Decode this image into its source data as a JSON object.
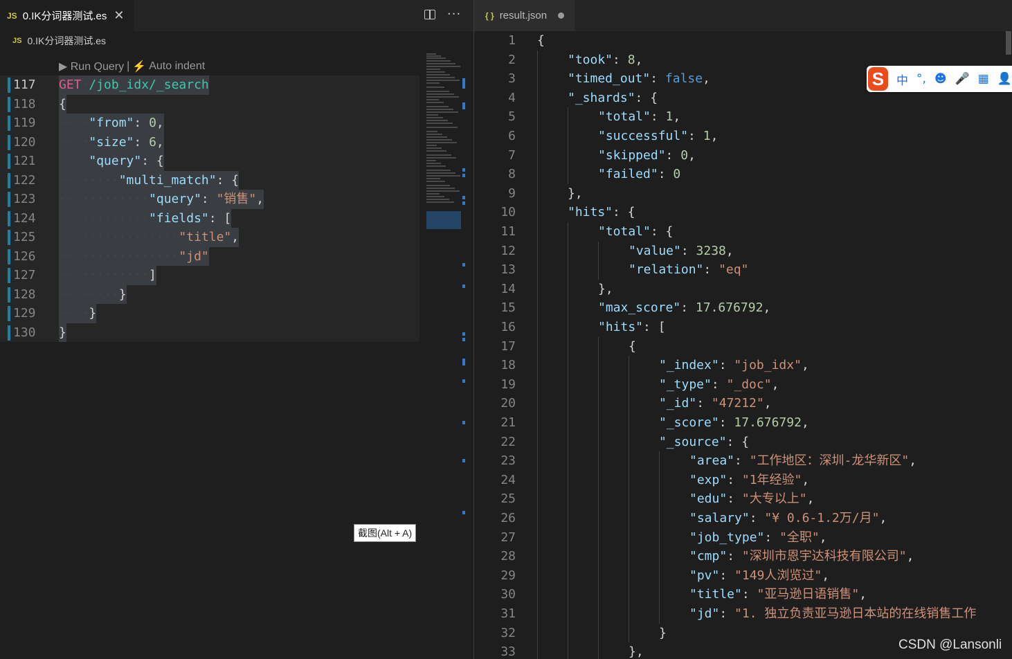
{
  "left_editor": {
    "tab": {
      "badge": "JS",
      "title": "0.IK分词器测试.es",
      "close": "✕"
    },
    "actions": {
      "split": "split-editor",
      "more": "···"
    },
    "breadcrumb": {
      "badge": "JS",
      "file": "0.IK分词器测试.es"
    },
    "codelens": {
      "run": "▶ Run Query",
      "sep": "|",
      "bolt": "⚡",
      "indent": "Auto indent"
    },
    "lines": [
      {
        "no": "117",
        "tokens": [
          [
            "m",
            "GET"
          ],
          [
            "dots",
            "·"
          ],
          [
            "u",
            "/job_idx/_search"
          ]
        ]
      },
      {
        "no": "118",
        "tokens": [
          [
            "p",
            "{"
          ]
        ]
      },
      {
        "no": "119",
        "tokens": [
          [
            "dots",
            "····"
          ],
          [
            "k",
            "\"from\""
          ],
          [
            "p",
            ": "
          ],
          [
            "n",
            "0"
          ],
          [
            "p",
            ","
          ]
        ]
      },
      {
        "no": "120",
        "tokens": [
          [
            "dots",
            "····"
          ],
          [
            "k",
            "\"size\""
          ],
          [
            "p",
            ": "
          ],
          [
            "n",
            "6"
          ],
          [
            "p",
            ","
          ]
        ]
      },
      {
        "no": "121",
        "tokens": [
          [
            "dots",
            "····"
          ],
          [
            "k",
            "\"query\""
          ],
          [
            "p",
            ": {"
          ]
        ]
      },
      {
        "no": "122",
        "tokens": [
          [
            "dots",
            "········"
          ],
          [
            "k",
            "\"multi_match\""
          ],
          [
            "p",
            ": {"
          ]
        ]
      },
      {
        "no": "123",
        "tokens": [
          [
            "dots",
            "············"
          ],
          [
            "k",
            "\"query\""
          ],
          [
            "p",
            ": "
          ],
          [
            "s",
            "\"销售\""
          ],
          [
            "p",
            ","
          ]
        ]
      },
      {
        "no": "124",
        "tokens": [
          [
            "dots",
            "············"
          ],
          [
            "k",
            "\"fields\""
          ],
          [
            "p",
            ": ["
          ]
        ]
      },
      {
        "no": "125",
        "tokens": [
          [
            "dots",
            "················"
          ],
          [
            "s",
            "\"title\""
          ],
          [
            "p",
            ","
          ]
        ]
      },
      {
        "no": "126",
        "tokens": [
          [
            "dots",
            "················"
          ],
          [
            "s",
            "\"jd\""
          ]
        ]
      },
      {
        "no": "127",
        "tokens": [
          [
            "dots",
            "············"
          ],
          [
            "p",
            "]"
          ]
        ]
      },
      {
        "no": "128",
        "tokens": [
          [
            "dots",
            "········"
          ],
          [
            "p",
            "}"
          ]
        ]
      },
      {
        "no": "129",
        "tokens": [
          [
            "dots",
            "····"
          ],
          [
            "p",
            "}"
          ]
        ]
      },
      {
        "no": "130",
        "tokens": [
          [
            "p",
            "}"
          ]
        ]
      }
    ]
  },
  "tooltip": "截图(Alt + A)",
  "right_editor": {
    "tab": {
      "icon": "{ }",
      "title": "result.json"
    },
    "lines": [
      {
        "no": "1",
        "i": 0,
        "tokens": [
          [
            "p",
            "{"
          ]
        ]
      },
      {
        "no": "2",
        "i": 1,
        "tokens": [
          [
            "k",
            "\"took\""
          ],
          [
            "p",
            ": "
          ],
          [
            "n",
            "8"
          ],
          [
            "p",
            ","
          ]
        ]
      },
      {
        "no": "3",
        "i": 1,
        "tokens": [
          [
            "k",
            "\"timed_out\""
          ],
          [
            "p",
            ": "
          ],
          [
            "b",
            "false"
          ],
          [
            "p",
            ","
          ]
        ]
      },
      {
        "no": "4",
        "i": 1,
        "tokens": [
          [
            "k",
            "\"_shards\""
          ],
          [
            "p",
            ": {"
          ]
        ]
      },
      {
        "no": "5",
        "i": 2,
        "tokens": [
          [
            "k",
            "\"total\""
          ],
          [
            "p",
            ": "
          ],
          [
            "n",
            "1"
          ],
          [
            "p",
            ","
          ]
        ]
      },
      {
        "no": "6",
        "i": 2,
        "tokens": [
          [
            "k",
            "\"successful\""
          ],
          [
            "p",
            ": "
          ],
          [
            "n",
            "1"
          ],
          [
            "p",
            ","
          ]
        ]
      },
      {
        "no": "7",
        "i": 2,
        "tokens": [
          [
            "k",
            "\"skipped\""
          ],
          [
            "p",
            ": "
          ],
          [
            "n",
            "0"
          ],
          [
            "p",
            ","
          ]
        ]
      },
      {
        "no": "8",
        "i": 2,
        "tokens": [
          [
            "k",
            "\"failed\""
          ],
          [
            "p",
            ": "
          ],
          [
            "n",
            "0"
          ]
        ]
      },
      {
        "no": "9",
        "i": 1,
        "tokens": [
          [
            "p",
            "},"
          ]
        ]
      },
      {
        "no": "10",
        "i": 1,
        "tokens": [
          [
            "k",
            "\"hits\""
          ],
          [
            "p",
            ": {"
          ]
        ]
      },
      {
        "no": "11",
        "i": 2,
        "tokens": [
          [
            "k",
            "\"total\""
          ],
          [
            "p",
            ": {"
          ]
        ]
      },
      {
        "no": "12",
        "i": 3,
        "tokens": [
          [
            "k",
            "\"value\""
          ],
          [
            "p",
            ": "
          ],
          [
            "n",
            "3238"
          ],
          [
            "p",
            ","
          ]
        ]
      },
      {
        "no": "13",
        "i": 3,
        "tokens": [
          [
            "k",
            "\"relation\""
          ],
          [
            "p",
            ": "
          ],
          [
            "s",
            "\"eq\""
          ]
        ]
      },
      {
        "no": "14",
        "i": 2,
        "tokens": [
          [
            "p",
            "},"
          ]
        ]
      },
      {
        "no": "15",
        "i": 2,
        "tokens": [
          [
            "k",
            "\"max_score\""
          ],
          [
            "p",
            ": "
          ],
          [
            "n",
            "17.676792"
          ],
          [
            "p",
            ","
          ]
        ]
      },
      {
        "no": "16",
        "i": 2,
        "tokens": [
          [
            "k",
            "\"hits\""
          ],
          [
            "p",
            ": ["
          ]
        ]
      },
      {
        "no": "17",
        "i": 3,
        "tokens": [
          [
            "p",
            "{"
          ]
        ]
      },
      {
        "no": "18",
        "i": 4,
        "tokens": [
          [
            "k",
            "\"_index\""
          ],
          [
            "p",
            ": "
          ],
          [
            "s",
            "\"job_idx\""
          ],
          [
            "p",
            ","
          ]
        ]
      },
      {
        "no": "19",
        "i": 4,
        "tokens": [
          [
            "k",
            "\"_type\""
          ],
          [
            "p",
            ": "
          ],
          [
            "s",
            "\"_doc\""
          ],
          [
            "p",
            ","
          ]
        ]
      },
      {
        "no": "20",
        "i": 4,
        "tokens": [
          [
            "k",
            "\"_id\""
          ],
          [
            "p",
            ": "
          ],
          [
            "s",
            "\"47212\""
          ],
          [
            "p",
            ","
          ]
        ]
      },
      {
        "no": "21",
        "i": 4,
        "tokens": [
          [
            "k",
            "\"_score\""
          ],
          [
            "p",
            ": "
          ],
          [
            "n",
            "17.676792"
          ],
          [
            "p",
            ","
          ]
        ]
      },
      {
        "no": "22",
        "i": 4,
        "tokens": [
          [
            "k",
            "\"_source\""
          ],
          [
            "p",
            ": {"
          ]
        ]
      },
      {
        "no": "23",
        "i": 5,
        "tokens": [
          [
            "k",
            "\"area\""
          ],
          [
            "p",
            ": "
          ],
          [
            "s",
            "\"工作地区：深圳-龙华新区\""
          ],
          [
            "p",
            ","
          ]
        ]
      },
      {
        "no": "24",
        "i": 5,
        "tokens": [
          [
            "k",
            "\"exp\""
          ],
          [
            "p",
            ": "
          ],
          [
            "s",
            "\"1年经验\""
          ],
          [
            "p",
            ","
          ]
        ]
      },
      {
        "no": "25",
        "i": 5,
        "tokens": [
          [
            "k",
            "\"edu\""
          ],
          [
            "p",
            ": "
          ],
          [
            "s",
            "\"大专以上\""
          ],
          [
            "p",
            ","
          ]
        ]
      },
      {
        "no": "26",
        "i": 5,
        "tokens": [
          [
            "k",
            "\"salary\""
          ],
          [
            "p",
            ": "
          ],
          [
            "s",
            "\"¥ 0.6-1.2万/月\""
          ],
          [
            "p",
            ","
          ]
        ]
      },
      {
        "no": "27",
        "i": 5,
        "tokens": [
          [
            "k",
            "\"job_type\""
          ],
          [
            "p",
            ": "
          ],
          [
            "s",
            "\"全职\""
          ],
          [
            "p",
            ","
          ]
        ]
      },
      {
        "no": "28",
        "i": 5,
        "tokens": [
          [
            "k",
            "\"cmp\""
          ],
          [
            "p",
            ": "
          ],
          [
            "s",
            "\"深圳市恩宇达科技有限公司\""
          ],
          [
            "p",
            ","
          ]
        ]
      },
      {
        "no": "29",
        "i": 5,
        "tokens": [
          [
            "k",
            "\"pv\""
          ],
          [
            "p",
            ": "
          ],
          [
            "s",
            "\"149人浏览过\""
          ],
          [
            "p",
            ","
          ]
        ]
      },
      {
        "no": "30",
        "i": 5,
        "tokens": [
          [
            "k",
            "\"title\""
          ],
          [
            "p",
            ": "
          ],
          [
            "s",
            "\"亚马逊日语销售\""
          ],
          [
            "p",
            ","
          ]
        ]
      },
      {
        "no": "31",
        "i": 5,
        "tokens": [
          [
            "k",
            "\"jd\""
          ],
          [
            "p",
            ": "
          ],
          [
            "s",
            "\"1. 独立负责亚马逊日本站的在线销售工作"
          ]
        ]
      },
      {
        "no": "32",
        "i": 4,
        "tokens": [
          [
            "p",
            "}"
          ]
        ]
      },
      {
        "no": "33",
        "i": 3,
        "tokens": [
          [
            "p",
            "},"
          ]
        ]
      }
    ]
  },
  "ime": {
    "logo": "S",
    "items": [
      "中",
      "°,",
      "☻",
      "🎤",
      "▦",
      "👤"
    ]
  },
  "watermark": "CSDN @Lansonli"
}
